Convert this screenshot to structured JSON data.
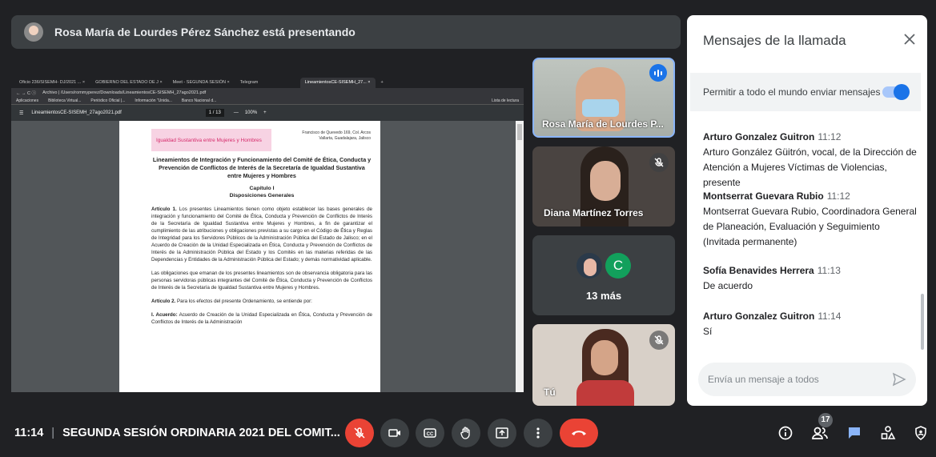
{
  "banner": {
    "text": "Rosa María de Lourdes Pérez Sánchez está presentando"
  },
  "screen": {
    "tabs": [
      "Oficio 236/SISEMH- DJ/2021 ... ×",
      "GOBIERNO DEL ESTADO DE J ×",
      "Meet - SEGUNDA SESIÓN ×",
      "Telegram",
      "LineamientosCE-SISEMH_27... ×",
      "+"
    ],
    "address": "Archivo | /Users/rommyperez/Downloads/LineamientosCE-SISEMH_27ago2021.pdf",
    "bookmarks": [
      "Aplicaciones",
      "Biblioteca Virtual...",
      "Periódico Oficial |...",
      "Información \"Unida...",
      "Banco Nacional d...",
      "Lista de lectura"
    ],
    "pdf_file": "LineamientosCE-SISEMH_27ago2021.pdf",
    "pdf_page": "1 / 13",
    "pdf_zoom": "100%",
    "doc": {
      "logo": "Igualdad Sustantiva entre Mujeres y Hombres",
      "address": "Francisco de Quevedo 169, Col. Arcos Vallarta, Guadalajara, Jalisco",
      "title": "Lineamientos de Integración y Funcionamiento del Comité de Ética, Conducta y Prevención de Conflictos de Interés de la Secretaría de Igualdad Sustantiva entre Mujeres y Hombres",
      "chapter": "Capítulo I",
      "chapter_sub": "Disposiciones Generales",
      "art1_label": "Artículo 1.",
      "art1": " Los presentes Lineamientos tienen como objeto establecer las bases generales de integración y funcionamiento del Comité de Ética, Conducta y Prevención de Conflictos de Interés de la Secretaría de Igualdad Sustantiva entre Mujeres y Hombres, a fin de garantizar el cumplimiento de las atribuciones y obligaciones previstas a su cargo en el Código de Ética y Reglas de Integridad para los Servidores Públicos de la Administración Pública del Estado de Jalisco; en el Acuerdo de Creación de la Unidad Especializada en Ética, Conducta y Prevención de Conflictos de Interés de la Administración Pública del Estado y los Comités en las materias referidas de las Dependencias y Entidades de la Administración Pública del Estado; y demás normatividad aplicable.",
      "para2": "Las obligaciones que emanan de los presentes lineamientos son de observancia obligatoria para las personas servidoras públicas integrantes del Comité de Ética, Conducta y Prevención de Conflictos de Interés de la Secretaría de Igualdad Sustantiva entre Mujeres y Hombres.",
      "art2_label": "Artículo 2.",
      "art2": " Para los efectos del presente Ordenamiento, se entiende por:",
      "item1_label": "I. Acuerdo:",
      "item1": " Acuerdo de Creación de la Unidad Especializada en Ética, Conducta y Prevención de Conflictos de Interés de la Administración"
    }
  },
  "tiles": [
    {
      "name": "Rosa María de Lourdes P..."
    },
    {
      "name": "Diana Martínez Torres"
    },
    {
      "avatar_letter": "C",
      "more": "13 más"
    },
    {
      "name": "Tú"
    }
  ],
  "chat": {
    "title": "Mensajes de la llamada",
    "permission": "Permitir a todo el mundo enviar mensajes",
    "messages": [
      {
        "author": "Arturo Gonzalez Guitron",
        "time": "11:12",
        "text": "Arturo González Güitrón, vocal, de la Dirección de Atención a Mujeres Víctimas de Violencias, presente"
      },
      {
        "author": "Montserrat Guevara Rubio",
        "time": "11:12",
        "text": "Montserrat Guevara Rubio, Coordinadora General de Planeación, Evaluación y Seguimiento (Invitada permanente)"
      },
      {
        "author": "Sofía Benavides Herrera",
        "time": "11:13",
        "text": "De acuerdo"
      },
      {
        "author": "Arturo Gonzalez Guitron",
        "time": "11:14",
        "text": "Sí"
      }
    ],
    "placeholder": "Envía un mensaje a todos"
  },
  "bottom": {
    "time": "11:14",
    "meeting": "SEGUNDA SESIÓN ORDINARIA 2021 DEL COMIT...",
    "participants": "17"
  },
  "colors": {
    "accent": "#1a73e8",
    "danger": "#ea4335",
    "bg": "#202124"
  }
}
